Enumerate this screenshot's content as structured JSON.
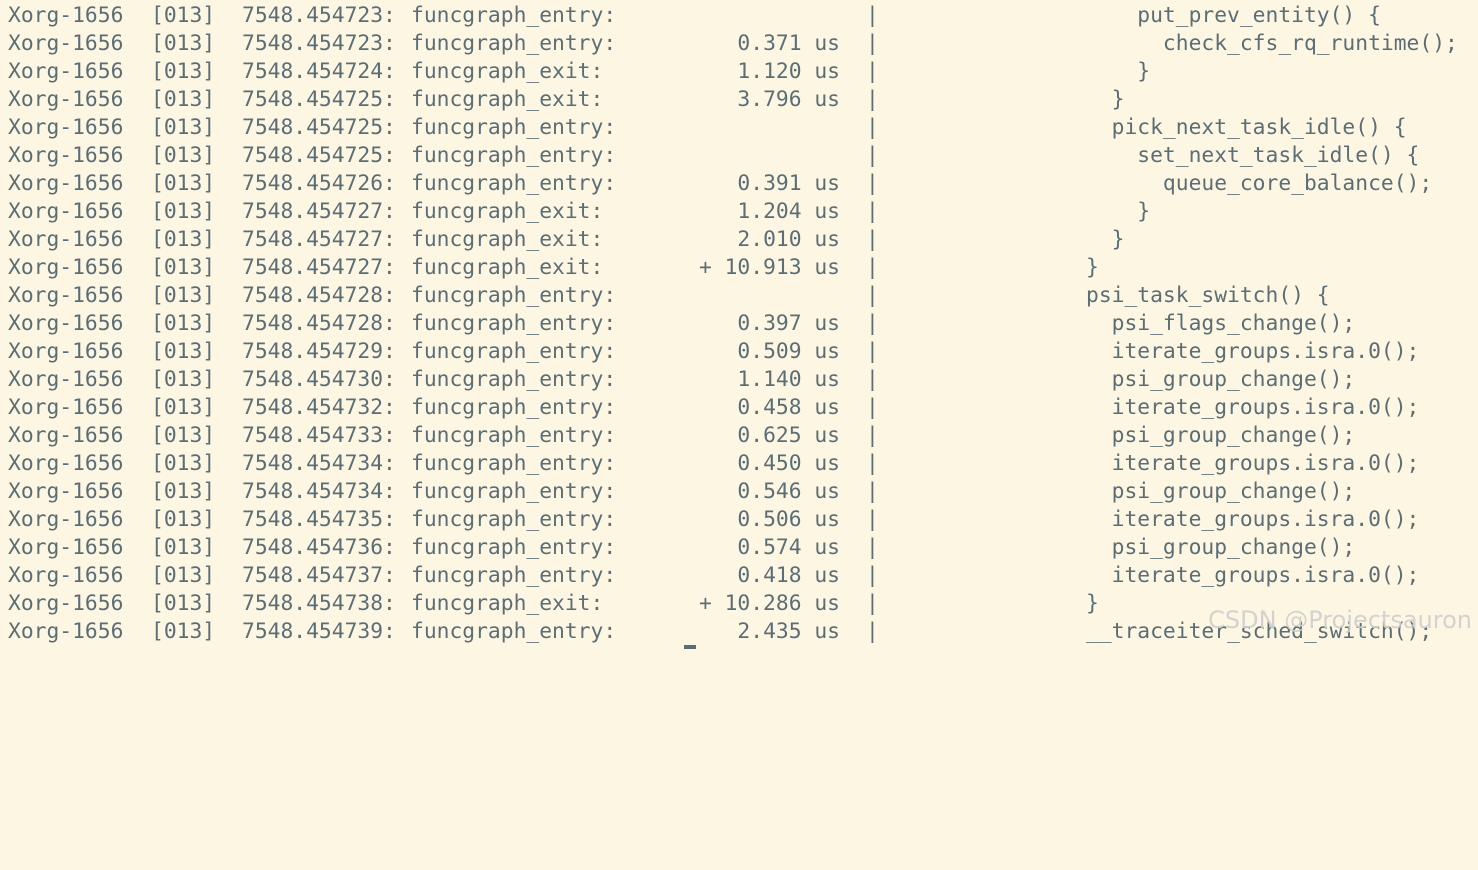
{
  "trace": {
    "rows": [
      {
        "process": "Xorg-1656",
        "cpu": "[013]",
        "timestamp": "7548.454723:",
        "event": "funcgraph_entry:",
        "duration": "",
        "separator": "|",
        "function": "    put_prev_entity() {"
      },
      {
        "process": "Xorg-1656",
        "cpu": "[013]",
        "timestamp": "7548.454723:",
        "event": "funcgraph_entry:",
        "duration": "0.371 us",
        "separator": "|",
        "function": "      check_cfs_rq_runtime();"
      },
      {
        "process": "Xorg-1656",
        "cpu": "[013]",
        "timestamp": "7548.454724:",
        "event": "funcgraph_exit:",
        "duration": "1.120 us",
        "separator": "|",
        "function": "    }"
      },
      {
        "process": "Xorg-1656",
        "cpu": "[013]",
        "timestamp": "7548.454725:",
        "event": "funcgraph_exit:",
        "duration": "3.796 us",
        "separator": "|",
        "function": "  }"
      },
      {
        "process": "Xorg-1656",
        "cpu": "[013]",
        "timestamp": "7548.454725:",
        "event": "funcgraph_entry:",
        "duration": "",
        "separator": "|",
        "function": "  pick_next_task_idle() {"
      },
      {
        "process": "Xorg-1656",
        "cpu": "[013]",
        "timestamp": "7548.454725:",
        "event": "funcgraph_entry:",
        "duration": "",
        "separator": "|",
        "function": "    set_next_task_idle() {"
      },
      {
        "process": "Xorg-1656",
        "cpu": "[013]",
        "timestamp": "7548.454726:",
        "event": "funcgraph_entry:",
        "duration": "0.391 us",
        "separator": "|",
        "function": "      queue_core_balance();"
      },
      {
        "process": "Xorg-1656",
        "cpu": "[013]",
        "timestamp": "7548.454727:",
        "event": "funcgraph_exit:",
        "duration": "1.204 us",
        "separator": "|",
        "function": "    }"
      },
      {
        "process": "Xorg-1656",
        "cpu": "[013]",
        "timestamp": "7548.454727:",
        "event": "funcgraph_exit:",
        "duration": "2.010 us",
        "separator": "|",
        "function": "  }"
      },
      {
        "process": "Xorg-1656",
        "cpu": "[013]",
        "timestamp": "7548.454727:",
        "event": "funcgraph_exit:",
        "duration": "+ 10.913 us",
        "separator": "|",
        "function": "}"
      },
      {
        "process": "Xorg-1656",
        "cpu": "[013]",
        "timestamp": "7548.454728:",
        "event": "funcgraph_entry:",
        "duration": "",
        "separator": "|",
        "function": "psi_task_switch() {"
      },
      {
        "process": "Xorg-1656",
        "cpu": "[013]",
        "timestamp": "7548.454728:",
        "event": "funcgraph_entry:",
        "duration": "0.397 us",
        "separator": "|",
        "function": "  psi_flags_change();"
      },
      {
        "process": "Xorg-1656",
        "cpu": "[013]",
        "timestamp": "7548.454729:",
        "event": "funcgraph_entry:",
        "duration": "0.509 us",
        "separator": "|",
        "function": "  iterate_groups.isra.0();"
      },
      {
        "process": "Xorg-1656",
        "cpu": "[013]",
        "timestamp": "7548.454730:",
        "event": "funcgraph_entry:",
        "duration": "1.140 us",
        "separator": "|",
        "function": "  psi_group_change();"
      },
      {
        "process": "Xorg-1656",
        "cpu": "[013]",
        "timestamp": "7548.454732:",
        "event": "funcgraph_entry:",
        "duration": "0.458 us",
        "separator": "|",
        "function": "  iterate_groups.isra.0();"
      },
      {
        "process": "Xorg-1656",
        "cpu": "[013]",
        "timestamp": "7548.454733:",
        "event": "funcgraph_entry:",
        "duration": "0.625 us",
        "separator": "|",
        "function": "  psi_group_change();"
      },
      {
        "process": "Xorg-1656",
        "cpu": "[013]",
        "timestamp": "7548.454734:",
        "event": "funcgraph_entry:",
        "duration": "0.450 us",
        "separator": "|",
        "function": "  iterate_groups.isra.0();"
      },
      {
        "process": "Xorg-1656",
        "cpu": "[013]",
        "timestamp": "7548.454734:",
        "event": "funcgraph_entry:",
        "duration": "0.546 us",
        "separator": "|",
        "function": "  psi_group_change();"
      },
      {
        "process": "Xorg-1656",
        "cpu": "[013]",
        "timestamp": "7548.454735:",
        "event": "funcgraph_entry:",
        "duration": "0.506 us",
        "separator": "|",
        "function": "  iterate_groups.isra.0();"
      },
      {
        "process": "Xorg-1656",
        "cpu": "[013]",
        "timestamp": "7548.454736:",
        "event": "funcgraph_entry:",
        "duration": "0.574 us",
        "separator": "|",
        "function": "  psi_group_change();"
      },
      {
        "process": "Xorg-1656",
        "cpu": "[013]",
        "timestamp": "7548.454737:",
        "event": "funcgraph_entry:",
        "duration": "0.418 us",
        "separator": "|",
        "function": "  iterate_groups.isra.0();"
      },
      {
        "process": "Xorg-1656",
        "cpu": "[013]",
        "timestamp": "7548.454738:",
        "event": "funcgraph_exit:",
        "duration": "+ 10.286 us",
        "separator": "|",
        "function": "}"
      },
      {
        "process": "Xorg-1656",
        "cpu": "[013]",
        "timestamp": "7548.454739:",
        "event": "funcgraph_entry:",
        "duration": "2.435 us",
        "separator": "|",
        "function": "__traceiter_sched_switch();"
      }
    ]
  },
  "watermark": "CSDN @Projectsauron",
  "colors": {
    "background": "#fdf6e3",
    "text": "#5b6e76",
    "watermark": "#cfcfcf"
  }
}
